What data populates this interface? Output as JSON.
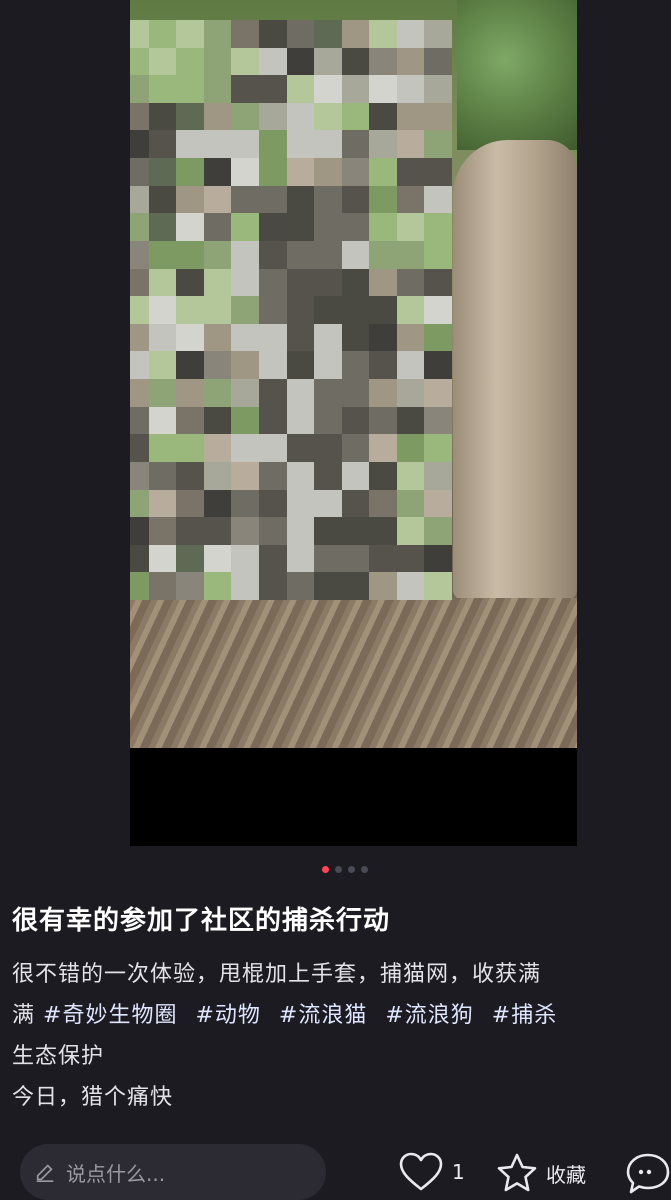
{
  "post": {
    "title": "很有幸的参加了社区的捕杀行动",
    "body_line1": "很不错的一次体验，甩棍加上手套，捕猫网，收获满",
    "tags": [
      "#奇妙生物圈",
      "#动物",
      "#流浪猫",
      "#流浪狗",
      "#捕杀"
    ],
    "prefix": "满",
    "body_line3": "生态保护",
    "body_line4": "今日，猎个痛快"
  },
  "carousel": {
    "total": 4,
    "active": 1
  },
  "bottom_bar": {
    "comment_placeholder": "说点什么...",
    "like_count": "1",
    "collect_label": "收藏"
  },
  "colors": {
    "background": "#1c1b22",
    "accent": "#ff4456"
  },
  "icons": [
    "pen-icon",
    "heart-icon",
    "star-icon",
    "comment-icon"
  ]
}
